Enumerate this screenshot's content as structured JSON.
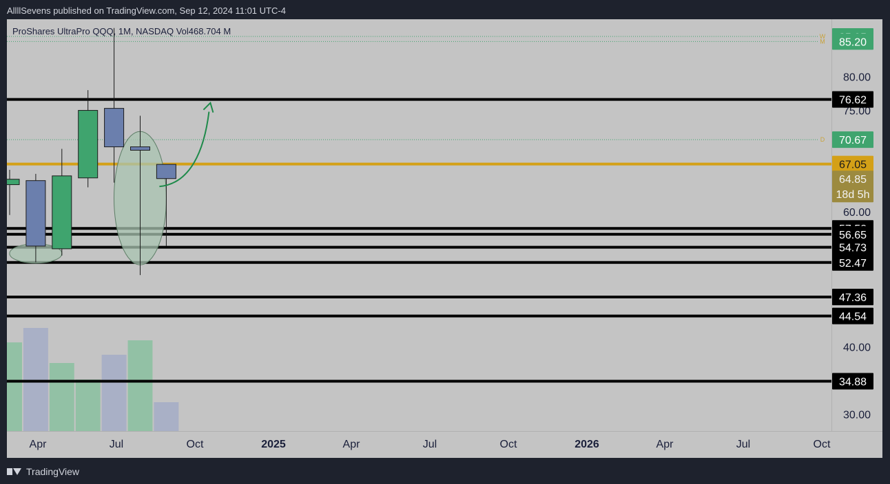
{
  "header": {
    "published": "AllllSevens published on TradingView.com, Sep 12, 2024 11:01 UTC-4"
  },
  "legend": {
    "symbol": "ProShares UltraPro QQQ, 1M, NASDAQ",
    "volume_label": "Vol",
    "volume_value": "468.704 M"
  },
  "footer": {
    "brand": "TradingView"
  },
  "colors": {
    "background": "#c4c4c4",
    "up": "#3fa46e",
    "down": "#6b7fad",
    "level_line": "#000000",
    "gold_line": "#d4a017",
    "dotted": "#3fa46e",
    "price_box_green": "#3fa46e",
    "price_box_gold": "#d4a017",
    "price_box_current": "#9c8a3f",
    "arrow": "#1e8a4a",
    "ellipse_fill": "#a9c4b2"
  },
  "chart_data": {
    "type": "candlestick",
    "timeframe": "1M",
    "ylim": [
      27.5,
      88.5
    ],
    "y_ticks": [
      "80.00",
      "75.00",
      "60.00",
      "40.00",
      "30.00"
    ],
    "x_ticks": [
      "Apr",
      "Jul",
      "Oct",
      "2025",
      "Apr",
      "Jul",
      "Oct",
      "2026",
      "Apr",
      "Jul",
      "Oct"
    ],
    "x_ticks_bold": [
      "2025",
      "2026"
    ],
    "candles": [
      {
        "open": 64.0,
        "high": 66.2,
        "low": 59.5,
        "close": 64.8
      },
      {
        "open": 64.6,
        "high": 65.6,
        "low": 52.5,
        "close": 54.9
      },
      {
        "open": 54.5,
        "high": 69.3,
        "low": 53.5,
        "close": 65.3
      },
      {
        "open": 65.0,
        "high": 78.0,
        "low": 63.6,
        "close": 75.0
      },
      {
        "open": 75.3,
        "high": 87.2,
        "low": 64.3,
        "close": 69.6
      },
      {
        "open": 69.6,
        "high": 74.2,
        "low": 50.6,
        "close": 69.1
      },
      {
        "open": 67.0,
        "high": 67.0,
        "low": 54.9,
        "close": 64.9
      }
    ],
    "volume": [
      {
        "value": 0.86,
        "dir": "up"
      },
      {
        "value": 1.0,
        "dir": "down"
      },
      {
        "value": 0.66,
        "dir": "up"
      },
      {
        "value": 0.5,
        "dir": "up"
      },
      {
        "value": 0.74,
        "dir": "down"
      },
      {
        "value": 0.88,
        "dir": "up"
      },
      {
        "value": 0.28,
        "dir": "down"
      }
    ],
    "levels": [
      "76.62",
      "57.52",
      "56.65",
      "54.73",
      "52.47",
      "47.36",
      "44.54",
      "34.88"
    ],
    "gold_level": "67.05",
    "dotted_levels": [
      {
        "value": "85.95",
        "marker": "W"
      },
      {
        "value": "85.20",
        "marker": "M"
      },
      {
        "value": "70.67",
        "marker": "D"
      }
    ],
    "current": {
      "price": "64.85",
      "countdown": "18d 5h"
    }
  }
}
